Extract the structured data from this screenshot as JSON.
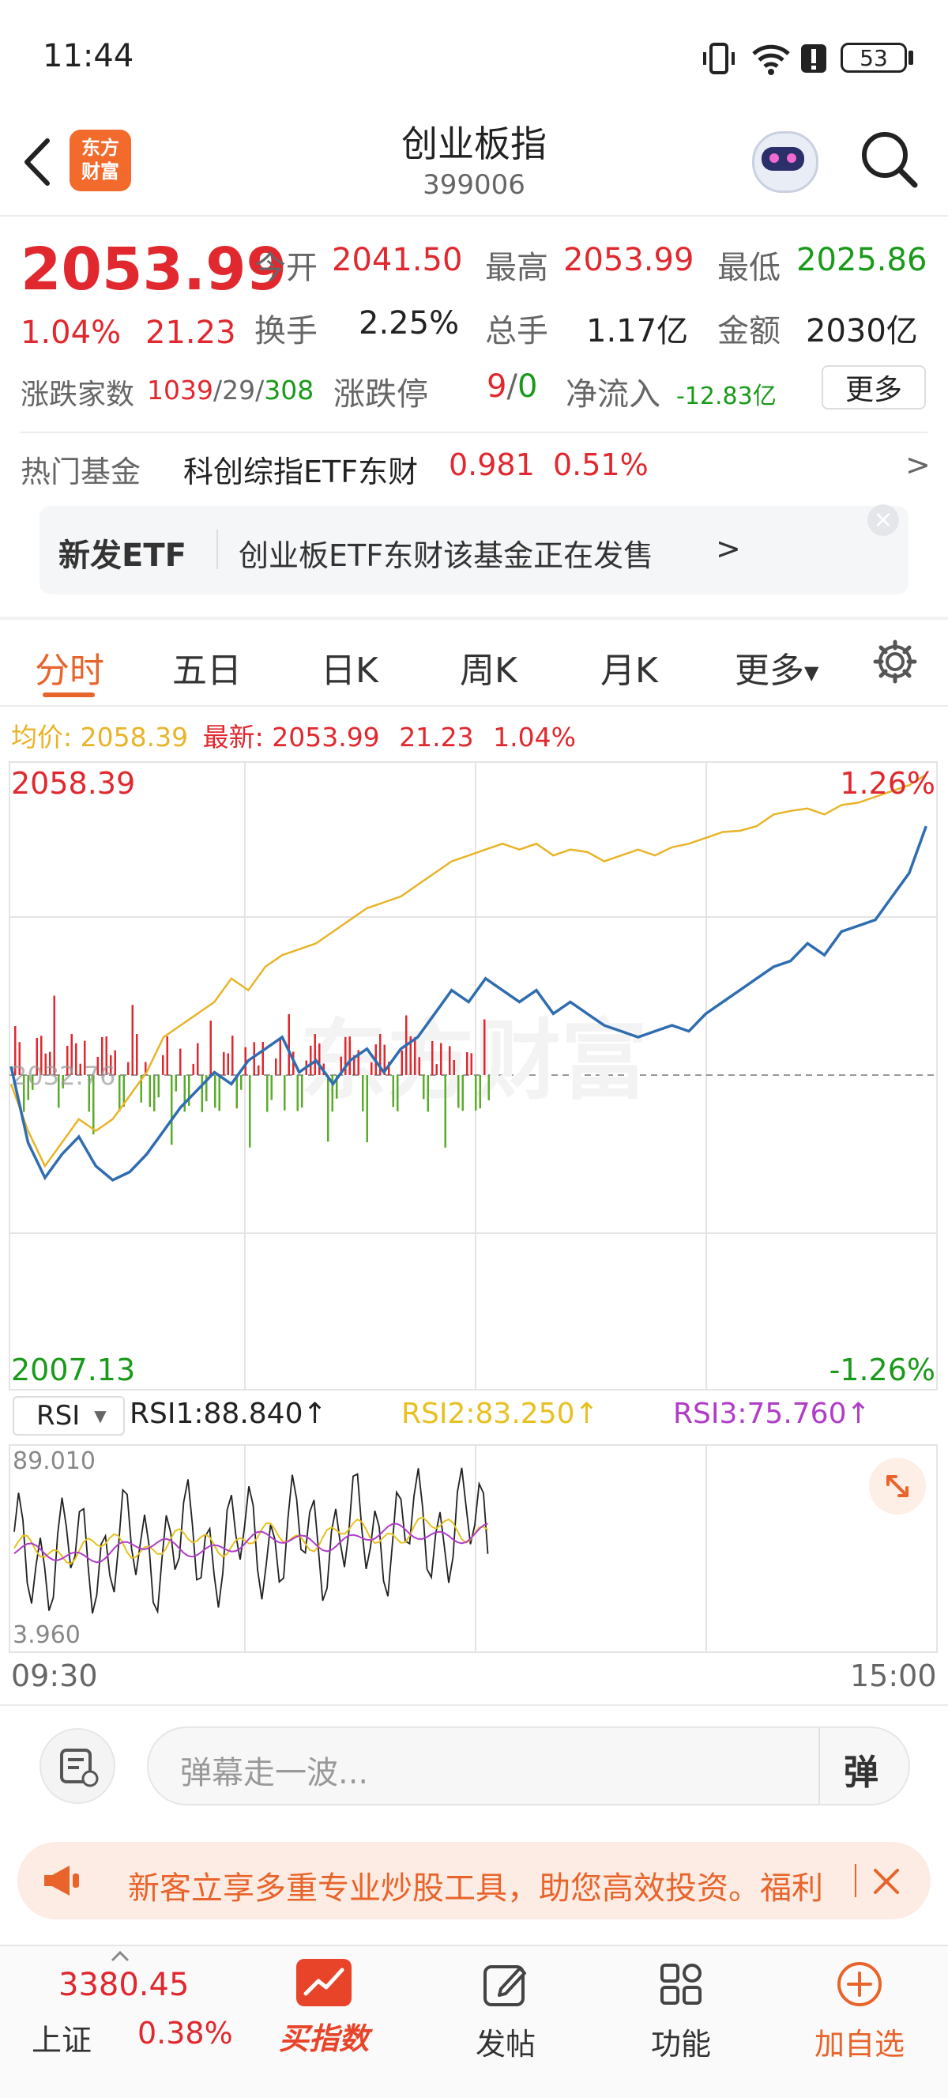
{
  "status_bar": {
    "time": "11:44",
    "battery": "53"
  },
  "header": {
    "title": "创业板指",
    "code": "399006",
    "logo_line1": "东方",
    "logo_line2": "财富"
  },
  "quote": {
    "price": "2053.99",
    "change_pct": "1.04%",
    "change": "21.23",
    "open_label": "今开",
    "open": "2041.50",
    "high_label": "最高",
    "high": "2053.99",
    "low_label": "最低",
    "low": "2025.86",
    "turnover_label": "换手",
    "turnover": "2.25%",
    "volume_label": "总手",
    "volume": "1.17亿",
    "amount_label": "金额",
    "amount": "2030亿",
    "breadth_label": "涨跌家数",
    "breadth_up": "1039",
    "breadth_flat": "29",
    "breadth_down": "308",
    "limit_label": "涨跌停",
    "limit_up": "9",
    "limit_down": "0",
    "netflow_label": "净流入",
    "netflow": "-12.83亿",
    "more_label": "更多"
  },
  "hot_fund": {
    "label": "热门基金",
    "name": "科创综指ETF东财",
    "price": "0.981",
    "pct": "0.51%",
    "arrow": ">"
  },
  "etf_banner": {
    "tag": "新发ETF",
    "text": "创业板ETF东财该基金正在发售",
    "arrow": ">"
  },
  "tabs": [
    "分时",
    "五日",
    "日K",
    "周K",
    "月K",
    "更多"
  ],
  "chart_header": {
    "avg_label": "均价:",
    "avg": "2058.39",
    "latest_label": "最新:",
    "latest": "2053.99",
    "latest_change": "21.23",
    "latest_pct": "1.04%"
  },
  "chart_data": {
    "type": "line",
    "x_range": [
      "09:30",
      "15:00"
    ],
    "y_range": [
      2007.13,
      2058.39
    ],
    "y_top_label": "2058.39",
    "y_bottom_label": "2007.13",
    "pct_top_label": "1.26%",
    "pct_bottom_label": "-1.26%",
    "pre_close_label": "2032.76",
    "watermark": "东方财富",
    "series": [
      {
        "color": "#2f6db0",
        "values": [
          2033.5,
          2027,
          2024,
          2026,
          2027.5,
          2025,
          2023.8,
          2024.5,
          2026,
          2028,
          2030,
          2031.5,
          2033,
          2032,
          2034,
          2035,
          2036,
          2033,
          2034,
          2032,
          2034,
          2035,
          2033,
          2035,
          2036,
          2038,
          2040,
          2039,
          2041,
          2040,
          2039,
          2040,
          2038,
          2039,
          2038,
          2037,
          2036.5,
          2036,
          2036.5,
          2037,
          2036.5,
          2038,
          2039,
          2040,
          2041,
          2042,
          2042.5,
          2044,
          2043,
          2045,
          2045.5,
          2046,
          2048,
          2050,
          2054
        ]
      },
      {
        "color": "#e8b428",
        "values": [
          2032,
          2028,
          2025,
          2027,
          2029,
          2028,
          2029,
          2031,
          2033,
          2036,
          2037,
          2038,
          2039,
          2041,
          2040,
          2042,
          2043,
          2043.5,
          2044,
          2045,
          2046,
          2047,
          2047.5,
          2048,
          2049,
          2050,
          2051,
          2051.5,
          2052,
          2052.5,
          2052,
          2052.5,
          2051.5,
          2052,
          2051.8,
          2051,
          2051.5,
          2052,
          2051.5,
          2052.2,
          2052.5,
          2053,
          2053.5,
          2053.6,
          2054,
          2055,
          2055.3,
          2055.5,
          2055,
          2055.8,
          2056,
          2056.5,
          2057,
          2057.5,
          2058.4
        ]
      }
    ]
  },
  "rsi": {
    "selector": "RSI",
    "rsi1": "RSI1:88.840↑",
    "rsi2": "RSI2:83.250↑",
    "rsi3": "RSI3:75.760↑",
    "top_label": "89.010",
    "bottom_label": "3.960",
    "start_time": "09:30",
    "end_time": "15:00"
  },
  "comment_bar": {
    "placeholder": "弹幕走一波...",
    "danmu_label": "弹"
  },
  "promo": {
    "text": "新客立享多重专业炒股工具，助您高效投资。福利"
  },
  "bottom_nav": {
    "index_value": "3380.45",
    "index_name": "上证",
    "index_pct": "0.38%",
    "buy_index": "买指数",
    "post": "发帖",
    "features": "功能",
    "add_watch": "加自选"
  },
  "colors": {
    "up": "#e0282e",
    "down": "#1a9a1a",
    "accent": "#e8642a",
    "avg_line": "#e8b428",
    "price_line": "#2f6db0"
  }
}
